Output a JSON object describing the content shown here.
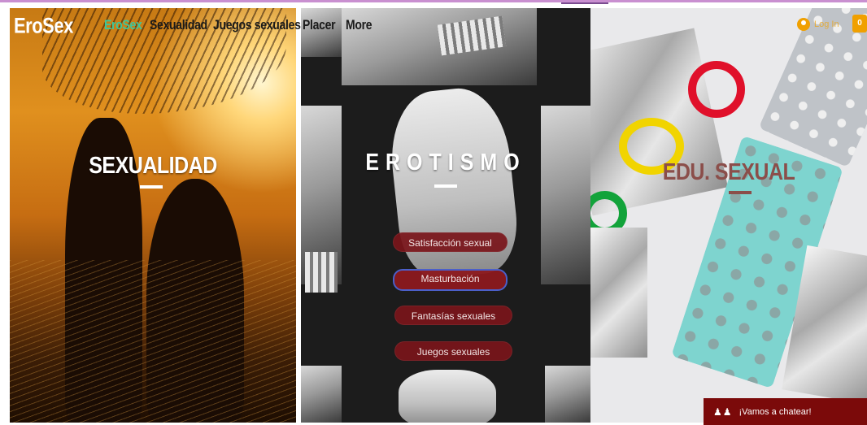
{
  "header": {
    "logo": "EroSex",
    "nav": [
      "EroSex",
      "Sexualidad",
      "Juegos sexuales",
      "Placer",
      "More"
    ],
    "active_nav": "EroSex",
    "login_label": "Log In",
    "cart_count": "0"
  },
  "panels": [
    {
      "title": "SEXUALIDAD"
    },
    {
      "title": "EROTISMO",
      "menu": [
        "Satisfacción sexual",
        "Masturbación",
        "Fantasías sexuales",
        "Juegos sexuales"
      ],
      "active_menu": "Masturbación"
    },
    {
      "title": "EDU. SEXUAL"
    }
  ],
  "chat": {
    "label": "¡Vamos a chatear!",
    "icon": "chat-people-icon"
  },
  "colors": {
    "accent": "#3ec79a",
    "menu_button": "#7a151a",
    "chat_button": "#7b0a0a",
    "login": "#f0a000",
    "top_rule": "#c98fd0"
  }
}
